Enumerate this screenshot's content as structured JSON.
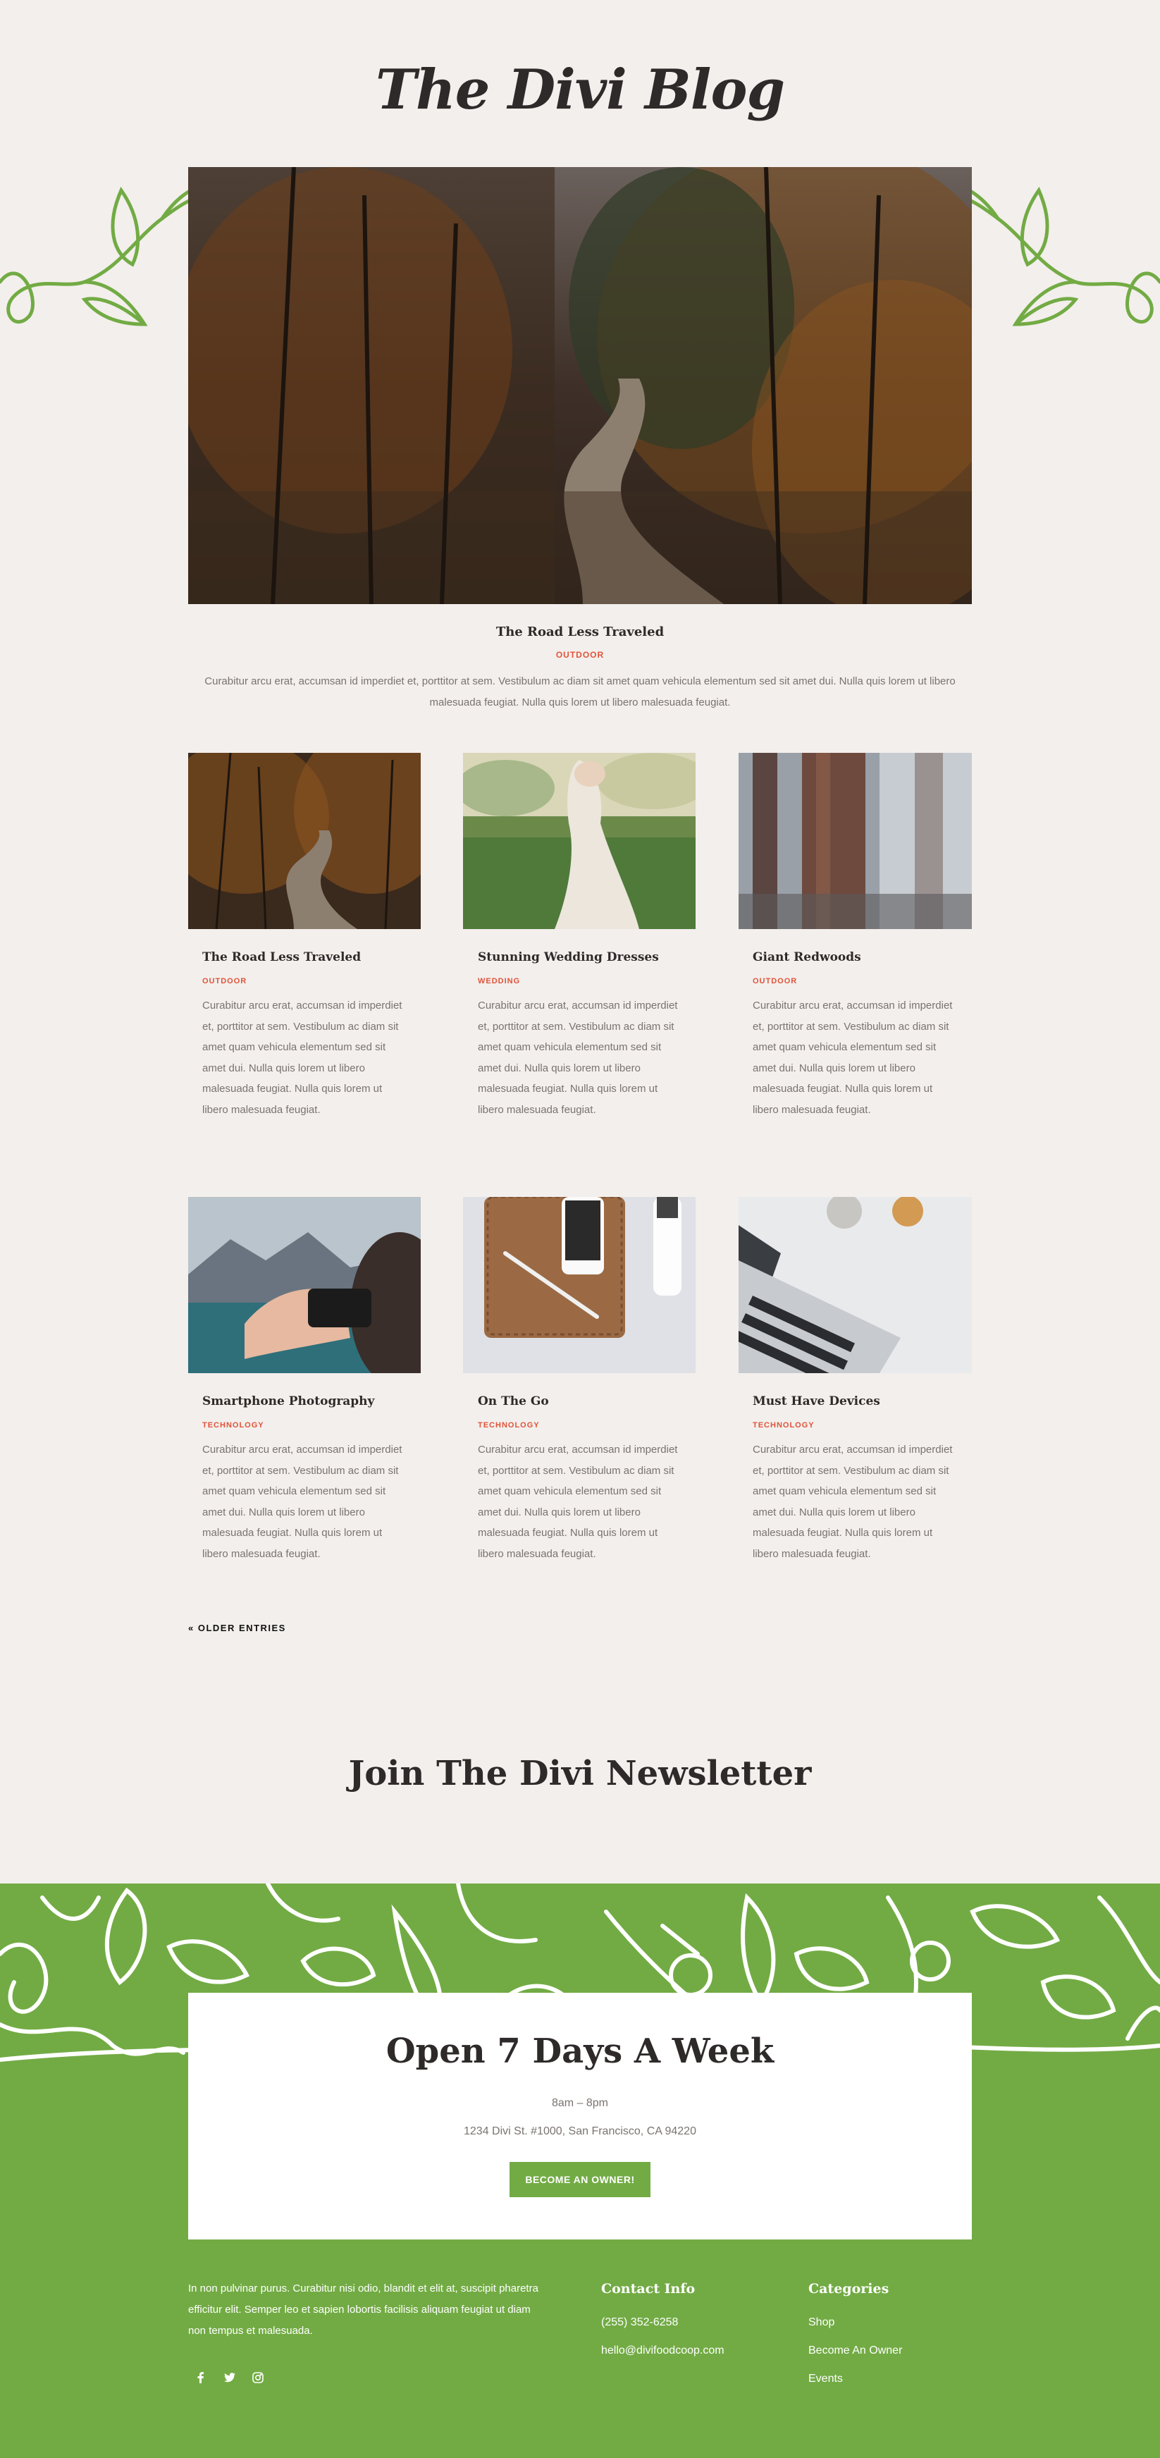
{
  "header": {
    "title": "The Divi Blog"
  },
  "featured": {
    "title": "The Road Less Traveled",
    "category": "OUTDOOR",
    "excerpt": "Curabitur arcu erat, accumsan id imperdiet et, porttitor at sem. Vestibulum ac diam sit amet quam vehicula elementum sed sit amet dui. Nulla quis lorem ut libero malesuada feugiat. Nulla quis lorem ut libero malesuada feugiat."
  },
  "posts": [
    {
      "title": "The Road Less Traveled",
      "category": "OUTDOOR",
      "excerpt": "Curabitur arcu erat, accumsan id imperdiet et, porttitor at sem. Vestibulum ac diam sit amet quam vehicula elementum sed sit amet dui. Nulla quis lorem ut libero malesuada feugiat. Nulla quis lorem ut libero malesuada feugiat."
    },
    {
      "title": "Stunning Wedding Dresses",
      "category": "WEDDING",
      "excerpt": "Curabitur arcu erat, accumsan id imperdiet et, porttitor at sem. Vestibulum ac diam sit amet quam vehicula elementum sed sit amet dui. Nulla quis lorem ut libero malesuada feugiat. Nulla quis lorem ut libero malesuada feugiat."
    },
    {
      "title": "Giant Redwoods",
      "category": "OUTDOOR",
      "excerpt": "Curabitur arcu erat, accumsan id imperdiet et, porttitor at sem. Vestibulum ac diam sit amet quam vehicula elementum sed sit amet dui. Nulla quis lorem ut libero malesuada feugiat. Nulla quis lorem ut libero malesuada feugiat."
    },
    {
      "title": "Smartphone Photography",
      "category": "TECHNOLOGY",
      "excerpt": "Curabitur arcu erat, accumsan id imperdiet et, porttitor at sem. Vestibulum ac diam sit amet quam vehicula elementum sed sit amet dui. Nulla quis lorem ut libero malesuada feugiat. Nulla quis lorem ut libero malesuada feugiat."
    },
    {
      "title": "On The Go",
      "category": "TECHNOLOGY",
      "excerpt": "Curabitur arcu erat, accumsan id imperdiet et, porttitor at sem. Vestibulum ac diam sit amet quam vehicula elementum sed sit amet dui. Nulla quis lorem ut libero malesuada feugiat. Nulla quis lorem ut libero malesuada feugiat."
    },
    {
      "title": "Must Have Devices",
      "category": "TECHNOLOGY",
      "excerpt": "Curabitur arcu erat, accumsan id imperdiet et, porttitor at sem. Vestibulum ac diam sit amet quam vehicula elementum sed sit amet dui. Nulla quis lorem ut libero malesuada feugiat. Nulla quis lorem ut libero malesuada feugiat."
    }
  ],
  "pagination": {
    "older_label": "« OLDER ENTRIES"
  },
  "newsletter": {
    "heading": "Join The Divi Newsletter"
  },
  "hours": {
    "heading": "Open 7 Days A Week",
    "time": "8am – 8pm",
    "address": "1234 Divi St. #1000, San Francisco, CA 94220",
    "button_label": "BECOME AN OWNER!"
  },
  "footer": {
    "about": "In non pulvinar purus. Curabitur nisi odio, blandit et elit at, suscipit pharetra efficitur elit. Semper leo et sapien lobortis facilisis aliquam feugiat ut diam non tempus et malesuada.",
    "contact_heading": "Contact Info",
    "phone": "(255) 352-6258",
    "email": "hello@divifoodcoop.com",
    "categories_heading": "Categories",
    "categories": [
      "Shop",
      "Become An Owner",
      "Events"
    ],
    "social_icons": [
      "facebook-icon",
      "twitter-icon",
      "instagram-icon"
    ]
  },
  "colors": {
    "accent": "#72ab44",
    "category": "#e0533a",
    "background": "#f3efec",
    "heading": "#2f2a2a"
  }
}
